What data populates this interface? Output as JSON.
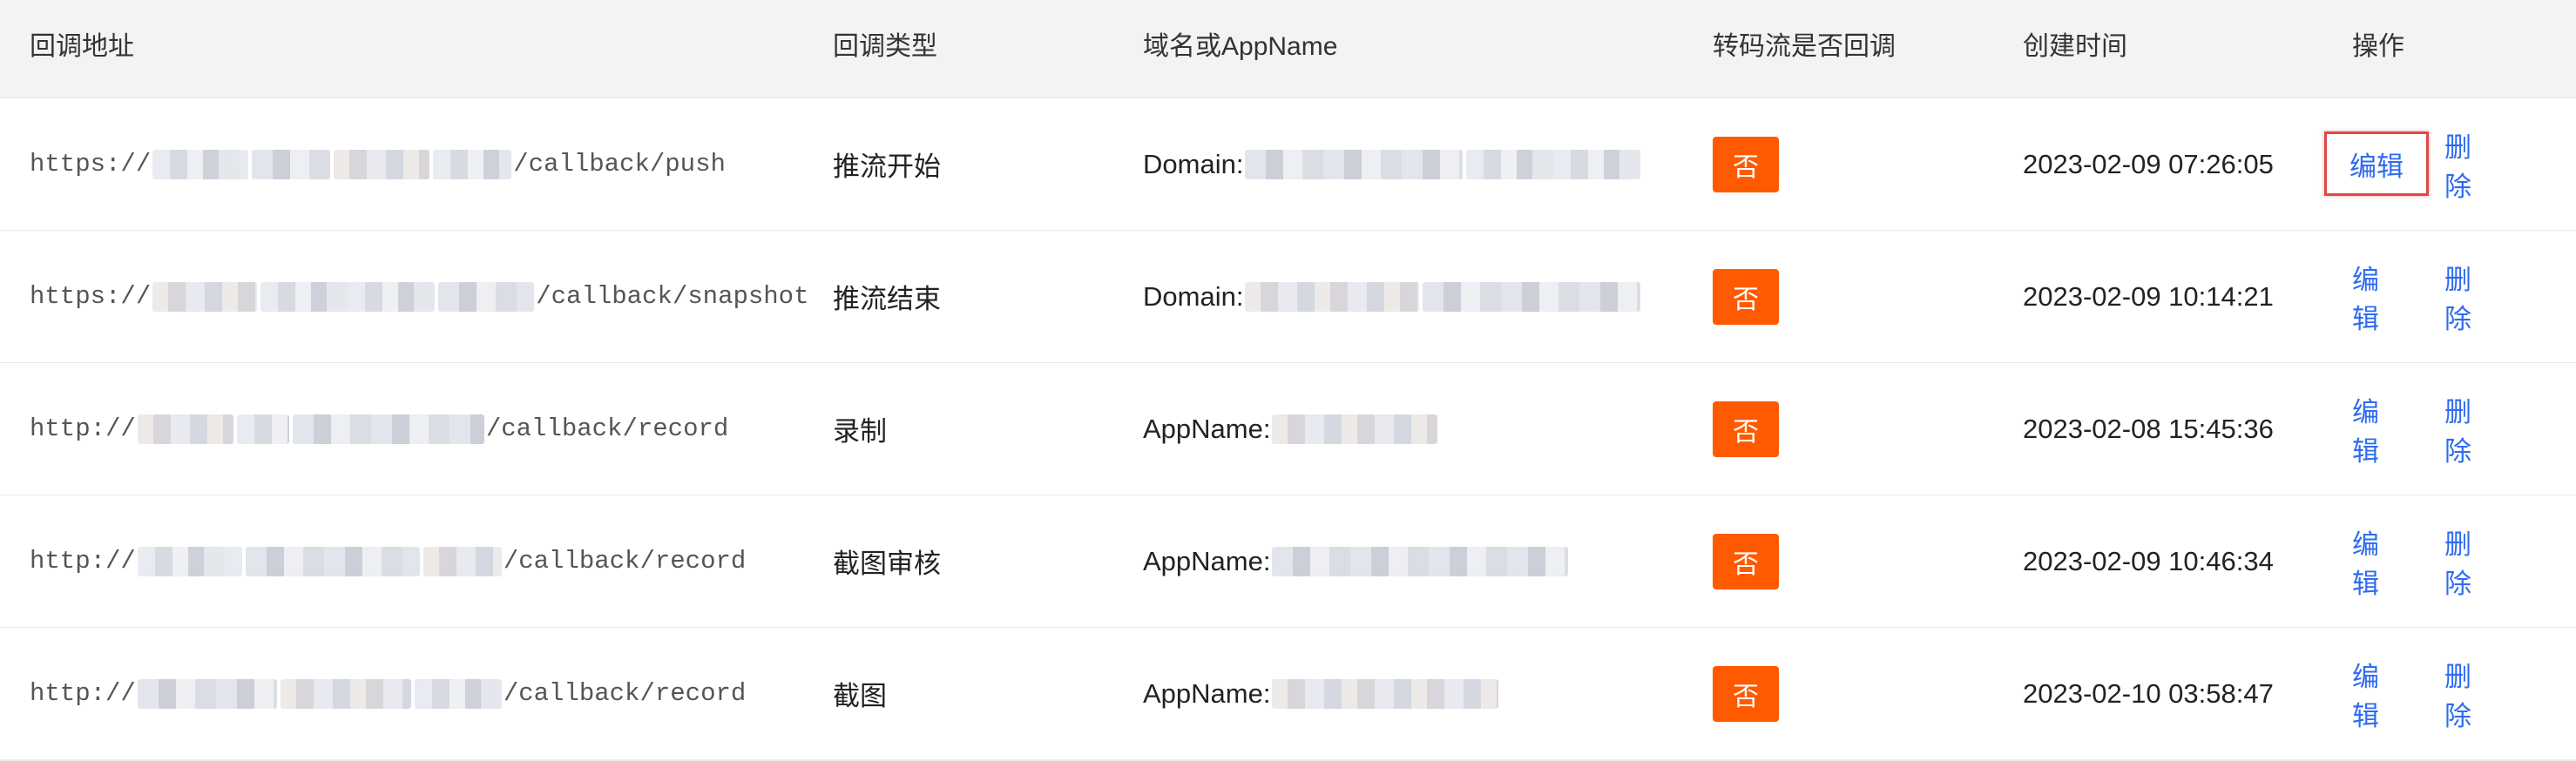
{
  "columns": {
    "url": "回调地址",
    "type": "回调类型",
    "domain": "域名或AppName",
    "transcode": "转码流是否回调",
    "created": "创建时间",
    "ops": "操作"
  },
  "rows": [
    {
      "scheme": "https://",
      "path": "/callback/push",
      "type": "推流开始",
      "domain_prefix": "Domain:",
      "transcode": "否",
      "created": "2023-02-09 07:26:05",
      "edit": "编辑",
      "delete": "删除"
    },
    {
      "scheme": "https://",
      "path": "/callback/snapshot",
      "type": "推流结束",
      "domain_prefix": "Domain:",
      "transcode": "否",
      "created": "2023-02-09 10:14:21",
      "edit": "编辑",
      "delete": "删除"
    },
    {
      "scheme": "http://",
      "path": "/callback/record",
      "type": "录制",
      "domain_prefix": "AppName:",
      "transcode": "否",
      "created": "2023-02-08 15:45:36",
      "edit": "编辑",
      "delete": "删除"
    },
    {
      "scheme": "http://",
      "path": "/callback/record",
      "type": "截图审核",
      "domain_prefix": "AppName:",
      "transcode": "否",
      "created": "2023-02-09 10:46:34",
      "edit": "编辑",
      "delete": "删除"
    },
    {
      "scheme": "http://",
      "path": "/callback/record",
      "type": "截图",
      "domain_prefix": "AppName:",
      "transcode": "否",
      "created": "2023-02-10 03:58:47",
      "edit": "编辑",
      "delete": "删除"
    }
  ],
  "colors": {
    "accent": "#2e6bf0",
    "badge": "#ff5a00",
    "highlight": "#e04848",
    "header_bg": "#f2f3f5"
  }
}
